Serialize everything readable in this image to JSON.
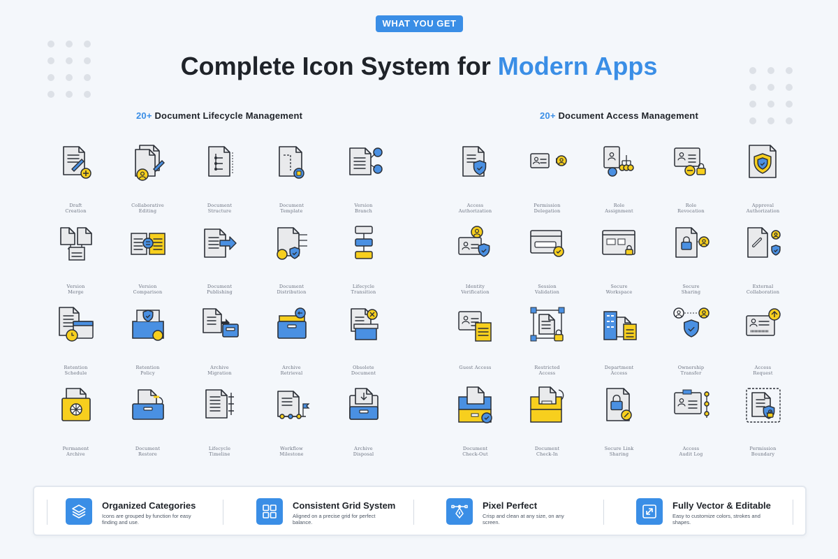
{
  "badge": "WHAT YOU GET",
  "title": {
    "main": "Complete Icon System for ",
    "accent": "Modern Apps"
  },
  "colors": {
    "accent": "#3a8ee6",
    "icon_yellow": "#f7cf1e",
    "icon_blue": "#4a90e2",
    "icon_gray": "#e9eaec",
    "outline": "#2b2f36"
  },
  "sections": {
    "lifecycle": {
      "count": "20+",
      "title": "Document Lifecycle Management",
      "items": [
        {
          "label": "Draft\nCreation",
          "icon": "draft-creation-icon"
        },
        {
          "label": "Collaborative\nEditing",
          "icon": "collaborative-editing-icon"
        },
        {
          "label": "Document\nStructure",
          "icon": "document-structure-icon"
        },
        {
          "label": "Document\nTemplate",
          "icon": "document-template-icon"
        },
        {
          "label": "Version\nBranch",
          "icon": "version-branch-icon"
        },
        {
          "label": "Version\nMerge",
          "icon": "version-merge-icon"
        },
        {
          "label": "Version\nComparison",
          "icon": "version-comparison-icon"
        },
        {
          "label": "Document\nPublishing",
          "icon": "document-publishing-icon"
        },
        {
          "label": "Document\nDistribution",
          "icon": "document-distribution-icon"
        },
        {
          "label": "Lifecycle\nTransition",
          "icon": "lifecycle-transition-icon"
        },
        {
          "label": "Retention\nSchedule",
          "icon": "retention-schedule-icon"
        },
        {
          "label": "Retention\nPolicy",
          "icon": "retention-policy-icon"
        },
        {
          "label": "Archive\nMigration",
          "icon": "archive-migration-icon"
        },
        {
          "label": "Archive\nRetrieval",
          "icon": "archive-retrieval-icon"
        },
        {
          "label": "Obsolete\nDocument",
          "icon": "obsolete-document-icon"
        },
        {
          "label": "Permanent\nArchive",
          "icon": "permanent-archive-icon"
        },
        {
          "label": "Document\nRestore",
          "icon": "document-restore-icon"
        },
        {
          "label": "Lifecycle\nTimeline",
          "icon": "lifecycle-timeline-icon"
        },
        {
          "label": "Workflow\nMilestone",
          "icon": "workflow-milestone-icon"
        },
        {
          "label": "Archive\nDisposal",
          "icon": "archive-disposal-icon"
        }
      ]
    },
    "access": {
      "count": "20+",
      "title": "Document Access Management",
      "items": [
        {
          "label": "Access\nAuthorization",
          "icon": "access-authorization-icon"
        },
        {
          "label": "Permission\nDelegation",
          "icon": "permission-delegation-icon"
        },
        {
          "label": "Role\nAssignment",
          "icon": "role-assignment-icon"
        },
        {
          "label": "Role\nRevocation",
          "icon": "role-revocation-icon"
        },
        {
          "label": "Approval\nAuthorization",
          "icon": "approval-authorization-icon"
        },
        {
          "label": "Identity\nVerification",
          "icon": "identity-verification-icon"
        },
        {
          "label": "Session\nValidation",
          "icon": "session-validation-icon"
        },
        {
          "label": "Secure\nWorkspace",
          "icon": "secure-workspace-icon"
        },
        {
          "label": "Secure\nSharing",
          "icon": "secure-sharing-icon"
        },
        {
          "label": "External\nCollaboration",
          "icon": "external-collaboration-icon"
        },
        {
          "label": "Guest Access",
          "icon": "guest-access-icon"
        },
        {
          "label": "Restricted\nAccess",
          "icon": "restricted-access-icon"
        },
        {
          "label": "Department\nAccess",
          "icon": "department-access-icon"
        },
        {
          "label": "Ownership\nTransfer",
          "icon": "ownership-transfer-icon"
        },
        {
          "label": "Access\nRequest",
          "icon": "access-request-icon"
        },
        {
          "label": "Document\nCheck-Out",
          "icon": "document-check-out-icon"
        },
        {
          "label": "Document\nCheck-In",
          "icon": "document-check-in-icon"
        },
        {
          "label": "Secure Link\nSharing",
          "icon": "secure-link-sharing-icon"
        },
        {
          "label": "Access\nAudit Log",
          "icon": "access-audit-log-icon"
        },
        {
          "label": "Permission\nBoundary",
          "icon": "permission-boundary-icon"
        }
      ]
    }
  },
  "features": [
    {
      "title": "Organized Categories",
      "desc": "Icons are grouped by function for easy finding and use.",
      "icon": "layers-icon"
    },
    {
      "title": "Consistent Grid System",
      "desc": "Aligned on a precise grid for perfect balance.",
      "icon": "grid-icon"
    },
    {
      "title": "Pixel Perfect",
      "desc": "Crisp and clean at any size, on any screen.",
      "icon": "pen-tool-icon"
    },
    {
      "title": "Fully Vector & Editable",
      "desc": "Easy to customize colors, strokes and shapes.",
      "icon": "resize-icon"
    }
  ]
}
